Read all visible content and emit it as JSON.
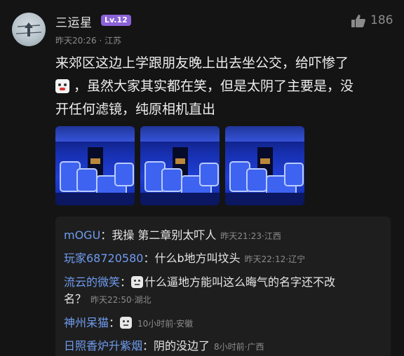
{
  "post": {
    "username": "三运星",
    "level": "Lv.12",
    "time": "昨天20:26",
    "location": "江苏",
    "likes": "186",
    "content_line1": "来郊区这边上学跟朋友晚上出去坐公交，给吓惨了",
    "content_line2": "，虽然大家其实都在笑，但是太阴了主要是，没",
    "content_line3": "开任何滤镜，纯原相机直出",
    "emoji_icon": "scared-face-emoji-icon",
    "photo_count": 3
  },
  "comments": [
    {
      "user": "mOGU",
      "sep": "：",
      "text": "我操 第二章别太吓人",
      "time": "昨天21:23",
      "location": "江西"
    },
    {
      "user": "玩家68720580",
      "sep": "：",
      "text": "什么b地方叫坟头",
      "time": "昨天22:12",
      "location": "辽宁"
    },
    {
      "user": "流云的微笑",
      "sep": "：",
      "text": "什么逼地方能叫这么晦气的名字还不改",
      "text2": "名？",
      "time": "昨天22:50",
      "location": "湖北",
      "emoji_icon": "face-emoji-icon"
    },
    {
      "user": "神州呆猫",
      "sep": "：",
      "text": "",
      "time": "10小时前",
      "location": "安徽",
      "emoji_icon": "face-emoji-icon"
    },
    {
      "user": "日照香炉升紫烟",
      "sep": "：",
      "text": "阴的没边了",
      "time": "8小时前",
      "location": "广西"
    }
  ],
  "icons": {
    "like": "thumbs-up-icon"
  },
  "colors": {
    "background": "#141414",
    "comment_user": "#6f9cf0",
    "level_badge": "#8a62d8",
    "comment_box": "#1e1e1e"
  }
}
